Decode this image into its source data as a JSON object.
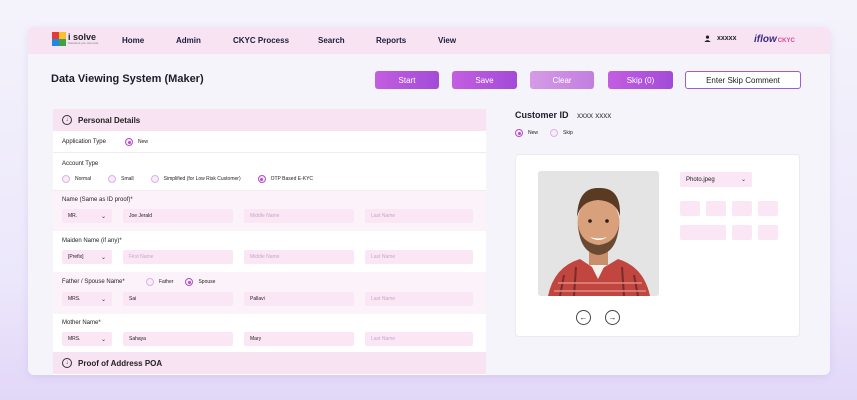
{
  "brand": {
    "logo_name": "i solve",
    "logo_tagline": "Solutions you can trust",
    "product": "iflow",
    "product_suffix": "CKYC"
  },
  "nav": {
    "items": [
      "Home",
      "Admin",
      "CKYC Process",
      "Search",
      "Reports",
      "View"
    ]
  },
  "user": {
    "name": "xxxxx",
    "icon": "user-icon"
  },
  "header": {
    "title": "Data Viewing System (Maker)"
  },
  "actions": {
    "start": "Start",
    "save": "Save",
    "clear": "Clear",
    "skip": "Skip (0)",
    "skip_comment": "Enter Skip Comment"
  },
  "personal": {
    "title": "Personal Details",
    "application_type": {
      "label": "Application Type",
      "options": [
        "New"
      ],
      "selected": "New"
    },
    "account_type": {
      "label": "Account Type",
      "options": [
        "Normal",
        "Small",
        "Simplified (for Low Risk Customer)",
        "OTP Based E-KYC"
      ],
      "selected": "OTP Based E-KYC"
    },
    "name": {
      "label": "Name (Same as ID proof)*",
      "prefix": "MR.",
      "first": "Joe Jerald",
      "middle_placeholder": "Middle Name",
      "last_placeholder": "Last Name"
    },
    "maiden": {
      "label": "Maiden Name (if any)*",
      "prefix": "[Prefix]",
      "first_placeholder": "First Name",
      "middle_placeholder": "Middle Name",
      "last_placeholder": "Last Name"
    },
    "father_spouse": {
      "label": "Father / Spouse Name*",
      "options": [
        "Father",
        "Spouse"
      ],
      "selected": "Spouse",
      "prefix": "MRS.",
      "first": "Sai",
      "middle": "Pallavi",
      "last_placeholder": "Last Name"
    },
    "mother": {
      "label": "Mother Name*",
      "prefix": "MRS.",
      "first": "Sahaya",
      "middle": "Mary",
      "last_placeholder": "Last Name"
    }
  },
  "poa": {
    "title": "Proof of Address POA"
  },
  "customer": {
    "id_label": "Customer ID",
    "id_value": "xxxx xxxx",
    "options": [
      "New",
      "Skip"
    ],
    "selected": "New",
    "file": "Photo.jpeg"
  },
  "colors": {
    "accent": "#b050c8",
    "nav_bg": "#f8e3f3",
    "field_bg": "#fae6f5"
  }
}
